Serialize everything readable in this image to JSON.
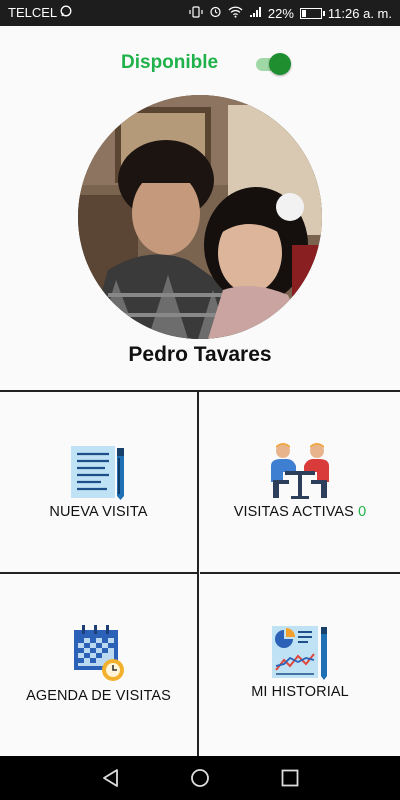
{
  "status_bar": {
    "carrier": "TELCEL",
    "battery": "22%",
    "battery_level": 0.22,
    "time": "11:26 a. m.",
    "icons": [
      "whatsapp-icon",
      "vibrate-icon",
      "alarm-icon",
      "wifi-icon",
      "signal-icon",
      "battery-icon"
    ]
  },
  "header": {
    "availability_label": "Disponible",
    "availability_on": true,
    "accent_color": "#20b24a"
  },
  "profile": {
    "name": "Pedro Tavares"
  },
  "menu": [
    {
      "label": "NUEVA VISITA",
      "icon": "document-pen-icon"
    },
    {
      "label": "VISITAS ACTIVAS",
      "count": "0",
      "icon": "meeting-people-icon"
    },
    {
      "label": "AGENDA DE VISITAS",
      "icon": "calendar-clock-icon"
    },
    {
      "label": "MI HISTORIAL",
      "icon": "report-chart-icon"
    }
  ],
  "nav_bar": {
    "icons": [
      "back-icon",
      "home-icon",
      "recents-icon"
    ]
  }
}
